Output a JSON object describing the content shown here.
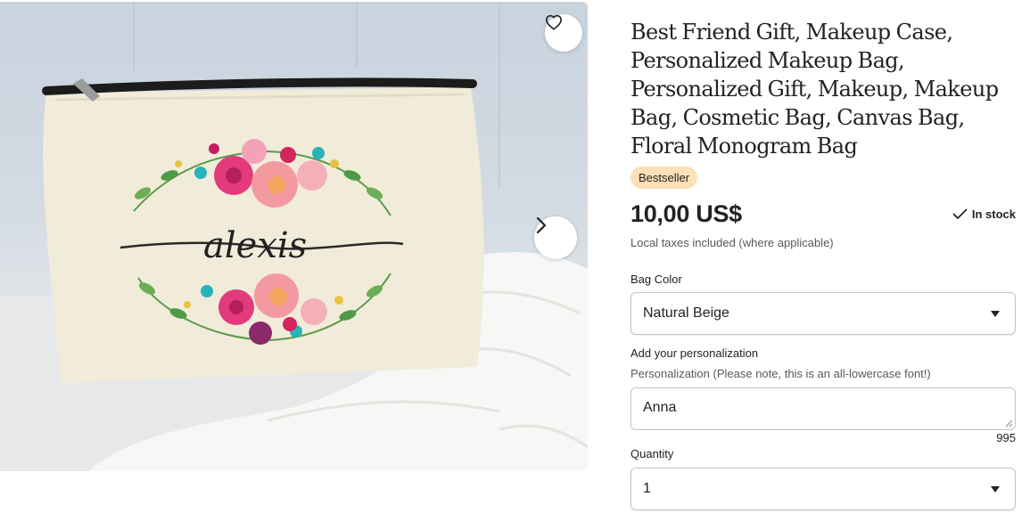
{
  "product": {
    "title": "Best Friend Gift, Makeup Case, Personalized Makeup Bag, Personalized Gift, Makeup, Makeup Bag, Cosmetic Bag, Canvas Bag, Floral Monogram Bag",
    "badge": "Bestseller",
    "price": "10,00 US$",
    "stock": "In stock",
    "taxes_note": "Local taxes included (where applicable)"
  },
  "image": {
    "printed_name": "alexis",
    "icons": {
      "favorite": "heart-icon",
      "next": "chevron-right-icon"
    }
  },
  "options": {
    "bag_color": {
      "label": "Bag Color",
      "selected": "Natural Beige"
    },
    "personalization": {
      "label": "Add your personalization",
      "instructions": "Personalization (Please note, this is an all-lowercase font!)",
      "value": "Anna",
      "remaining_chars": "995"
    },
    "quantity": {
      "label": "Quantity",
      "selected": "1"
    }
  },
  "colors": {
    "badge_bg": "#fde0b8",
    "text": "#222222",
    "muted": "#595959",
    "border": "#c3c3c3"
  }
}
